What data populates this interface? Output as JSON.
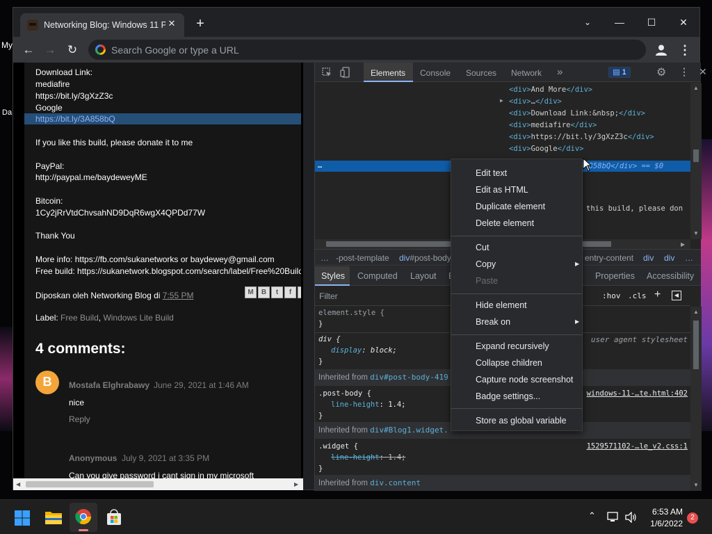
{
  "desktop": {
    "icon_label_1": "My",
    "icon_label_2": "Da"
  },
  "browser": {
    "tab_title": "Networking Blog: Windows 11 Pr",
    "omnibox_placeholder": "Search Google or type a URL"
  },
  "page": {
    "lines": [
      "Download Link:",
      "mediafire",
      "https://bit.ly/3gXzZ3c",
      "Google",
      "https://bit.ly/3A858bQ",
      "If you like this build, please donate it to me",
      "PayPal:",
      "http://paypal.me/baydeweyME",
      "Bitcoin:",
      "1Cy2jRrVtdChvsahND9DqR6wgX4QPDd77W",
      "Thank You",
      "More info: https://fb.com/sukanetworks or baydewey@gmail.com",
      "Free build: https://sukanetwork.blogspot.com/search/label/Free%20Build"
    ],
    "posted_by": "Diposkan oleh Networking Blog di",
    "posted_time": "7:55 PM",
    "label_prefix": "Label:",
    "label_1": "Free Build",
    "label_sep": ",",
    "label_2": "Windows Lite Build",
    "comments_heading": "4 comments:",
    "comments": [
      {
        "author": "Mostafa Elghrabawy",
        "date": "June 29, 2021 at 1:46 AM",
        "text": "nice",
        "reply": "Reply"
      },
      {
        "author": "Anonymous",
        "date": "July 9, 2021 at 3:35 PM",
        "text": "Can you give password i cant sign in my microsoft"
      }
    ]
  },
  "devtools": {
    "tabs": [
      "Elements",
      "Console",
      "Sources",
      "Network"
    ],
    "more": "»",
    "issues_count": "1",
    "dom_lines": [
      {
        "open": "<div>",
        "text": "And More",
        "close": "</div>"
      },
      {
        "open": "<div>",
        "text": "…",
        "close": "</div>"
      },
      {
        "open": "<div>",
        "text": "Download Link:&nbsp;",
        "close": "</div>"
      },
      {
        "open": "<div>",
        "text": "mediafire",
        "close": "</div>"
      },
      {
        "open": "<div>",
        "text": "https://bit.ly/3gXzZ3c",
        "close": "</div>"
      },
      {
        "open": "<div>",
        "text": "Google",
        "close": "</div>"
      }
    ],
    "selected_line": "ly/3A858bQ</div> == $0",
    "dom_more": "…",
    "dom_partial": "this build, please don",
    "breadcrumbs": [
      "…",
      "-post-template",
      "div#post-body",
      "entry-content",
      "div",
      "div",
      "…"
    ],
    "style_tabs": [
      "Styles",
      "Computed",
      "Layout",
      "E",
      "Properties",
      "Accessibility"
    ],
    "filter_placeholder": "Filter",
    "hov": ":hov",
    "cls": ".cls",
    "rules": {
      "element_style": "element.style {",
      "close_brace": "}",
      "div_selector": "div {",
      "div_prop": "display",
      "div_val": "block;",
      "ua_label": "user agent stylesheet",
      "inh1_prefix": "Inherited from",
      "inh1_sel": "div#post-body-419",
      "post_body_selector": ".post-body {",
      "post_body_prop": "line-height",
      "post_body_val": "1.4;",
      "post_body_src": "windows-11-…te.html:402",
      "inh2_prefix": "Inherited from",
      "inh2_sel": "div#Blog1.widget.",
      "widget_selector": ".widget {",
      "widget_prop": "line-height",
      "widget_val": "1.4;",
      "widget_src": "1529571102-…le_v2.css:1",
      "inh3_prefix": "Inherited from",
      "inh3_sel": "div.content"
    }
  },
  "context_menu": {
    "items": [
      "Edit text",
      "Edit as HTML",
      "Duplicate element",
      "Delete element",
      "Cut",
      "Copy",
      "Paste",
      "Hide element",
      "Break on",
      "Expand recursively",
      "Collapse children",
      "Capture node screenshot",
      "Badge settings...",
      "Store as global variable"
    ]
  },
  "taskbar": {
    "time": "6:53 AM",
    "date": "1/6/2022",
    "notification_count": "2"
  },
  "colors": {
    "accent": "#8ab4f8",
    "selection": "#0f5ca8",
    "highlight": "#264f78"
  }
}
